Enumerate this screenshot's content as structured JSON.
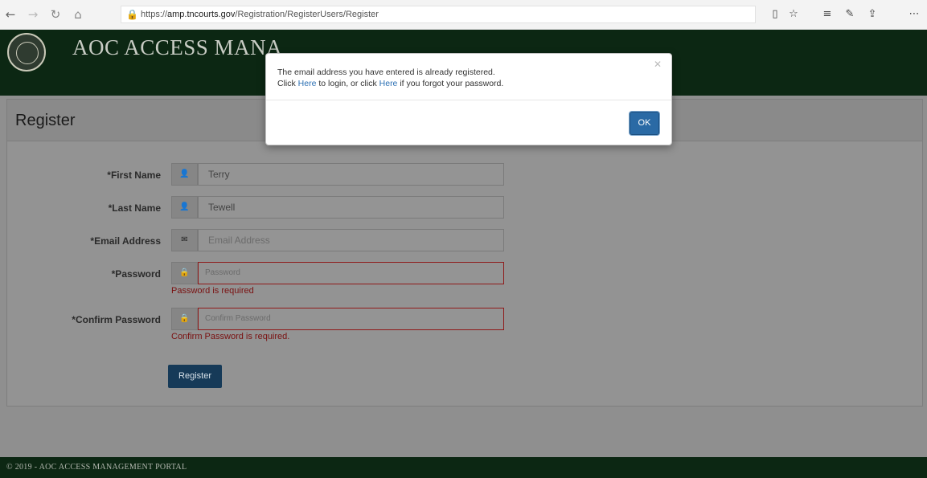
{
  "browser": {
    "url_prefix": "https://",
    "url_host": "amp.tncourts.gov",
    "url_path": "/Registration/RegisterUsers/Register"
  },
  "header": {
    "brand": "AOC ACCESS MANA"
  },
  "panel": {
    "title": "Register"
  },
  "form": {
    "first_name": {
      "label": "*First Name",
      "value": "Terry"
    },
    "last_name": {
      "label": "*Last Name",
      "value": "Tewell"
    },
    "email": {
      "label": "*Email Address",
      "placeholder": "Email Address"
    },
    "password": {
      "label": "*Password",
      "placeholder": "Password",
      "error": "Password is required"
    },
    "confirm": {
      "label": "*Confirm Password",
      "placeholder": "Confirm Password",
      "error": "Confirm Password is required."
    },
    "submit_label": "Register"
  },
  "footer": {
    "text": "© 2019 - AOC ACCESS MANAGEMENT PORTAL"
  },
  "modal": {
    "line1": "The email address you have entered is already registered.",
    "line2_a": "Click ",
    "line2_link1": "Here",
    "line2_b": " to login, or click ",
    "line2_link2": "Here",
    "line2_c": " if you forgot your password.",
    "ok_label": "OK"
  },
  "icons": {
    "user": "user-icon",
    "envelope": "envelope-icon",
    "lock": "lock-icon"
  }
}
